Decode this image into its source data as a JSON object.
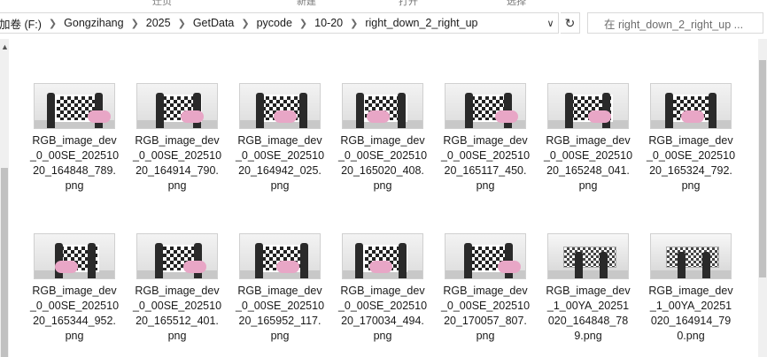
{
  "ribbon": {
    "labels": [
      "迁页",
      "新建",
      "打开",
      "选择"
    ]
  },
  "address": {
    "crumbs": [
      "加卷 (F:)",
      "Gongzihang",
      "2025",
      "GetData",
      "pycode",
      "10-20",
      "right_down_2_right_up"
    ]
  },
  "search": {
    "placeholder": "在 right_down_2_right_up ..."
  },
  "files": [
    {
      "line1": "RGB_image_dev",
      "line2": "_0_00SE_202510",
      "line3": "20_164848_789.",
      "line4": "png",
      "thumb": "checker"
    },
    {
      "line1": "RGB_image_dev",
      "line2": "_0_00SE_202510",
      "line3": "20_164914_790.",
      "line4": "png",
      "thumb": "checker"
    },
    {
      "line1": "RGB_image_dev",
      "line2": "_0_00SE_202510",
      "line3": "20_164942_025.",
      "line4": "png",
      "thumb": "checker"
    },
    {
      "line1": "RGB_image_dev",
      "line2": "_0_00SE_202510",
      "line3": "20_165020_408.",
      "line4": "png",
      "thumb": "checker"
    },
    {
      "line1": "RGB_image_dev",
      "line2": "_0_00SE_202510",
      "line3": "20_165117_450.",
      "line4": "png",
      "thumb": "checker"
    },
    {
      "line1": "RGB_image_dev",
      "line2": "_0_00SE_202510",
      "line3": "20_165248_041.",
      "line4": "png",
      "thumb": "checker"
    },
    {
      "line1": "RGB_image_dev",
      "line2": "_0_00SE_202510",
      "line3": "20_165324_792.",
      "line4": "png",
      "thumb": "checker"
    },
    {
      "line1": "RGB_image_dev",
      "line2": "_0_00SE_202510",
      "line3": "20_165344_952.",
      "line4": "png",
      "thumb": "checker"
    },
    {
      "line1": "RGB_image_dev",
      "line2": "_0_00SE_202510",
      "line3": "20_165512_401.",
      "line4": "png",
      "thumb": "checker"
    },
    {
      "line1": "RGB_image_dev",
      "line2": "_0_00SE_202510",
      "line3": "20_165952_117.",
      "line4": "png",
      "thumb": "checker"
    },
    {
      "line1": "RGB_image_dev",
      "line2": "_0_00SE_202510",
      "line3": "20_170034_494.",
      "line4": "png",
      "thumb": "checker"
    },
    {
      "line1": "RGB_image_dev",
      "line2": "_0_00SE_202510",
      "line3": "20_170057_807.",
      "line4": "png",
      "thumb": "checker"
    },
    {
      "line1": "RGB_image_dev",
      "line2": "_1_00YA_20251",
      "line3": "020_164848_78",
      "line4": "9.png",
      "thumb": "room"
    },
    {
      "line1": "RGB_image_dev",
      "line2": "_1_00YA_20251",
      "line3": "020_164914_79",
      "line4": "0.png",
      "thumb": "room"
    }
  ]
}
